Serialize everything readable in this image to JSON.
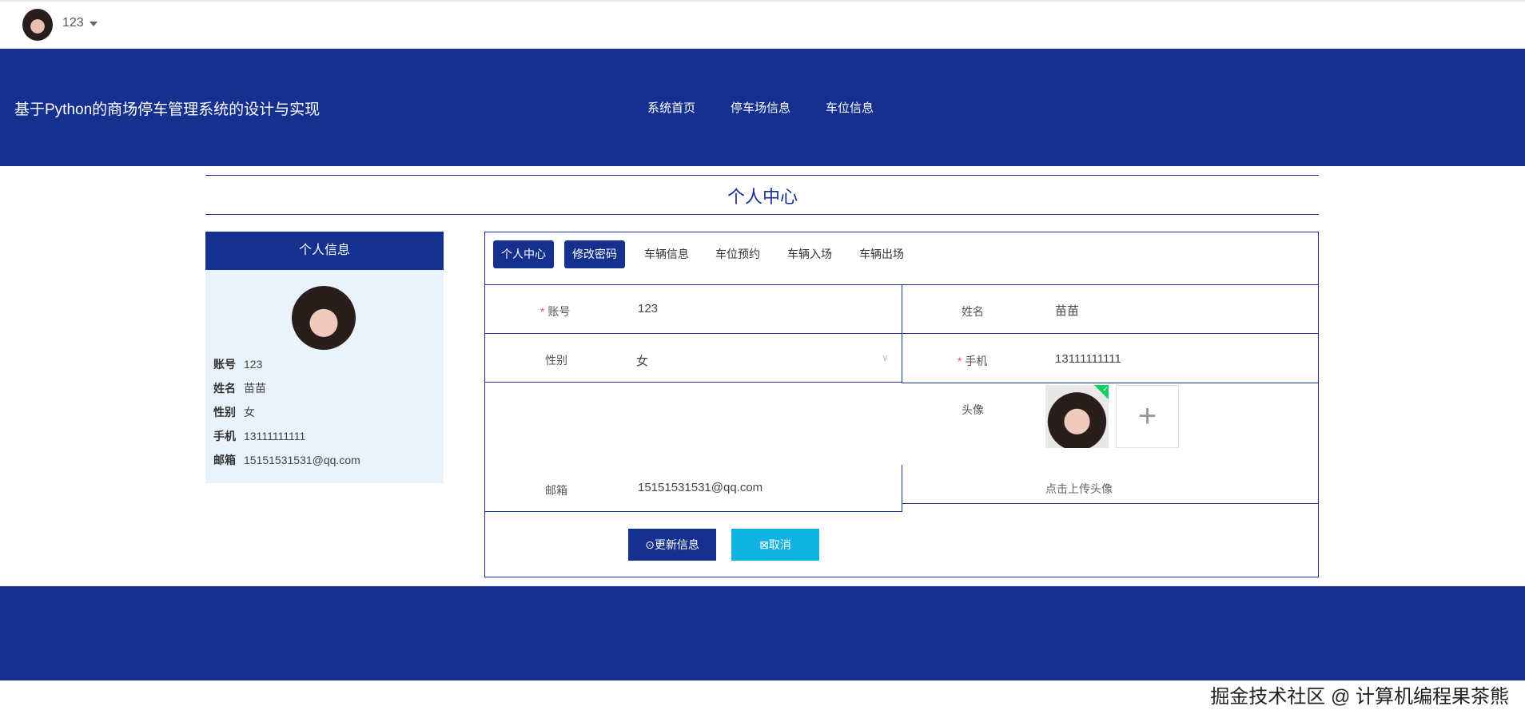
{
  "topbar": {
    "username": "123"
  },
  "header": {
    "title": "基于Python的商场停车管理系统的设计与实现",
    "nav": [
      "系统首页",
      "停车场信息",
      "车位信息"
    ]
  },
  "page_title": "个人中心",
  "profile_card": {
    "title": "个人信息",
    "fields": [
      {
        "label": "账号",
        "value": "123"
      },
      {
        "label": "姓名",
        "value": "苗苗"
      },
      {
        "label": "性别",
        "value": "女"
      },
      {
        "label": "手机",
        "value": "13111111111"
      },
      {
        "label": "邮箱",
        "value": "15151531531@qq.com"
      }
    ]
  },
  "tabs": [
    "个人中心",
    "修改密码",
    "车辆信息",
    "车位预约",
    "车辆入场",
    "车辆出场"
  ],
  "form": {
    "account_label": "账号",
    "account": "123",
    "name_label": "姓名",
    "name": "苗苗",
    "gender_label": "性别",
    "gender": "女",
    "phone_label": "手机",
    "phone": "13111111111",
    "avatar_label": "头像",
    "avatar_hint": "点击上传头像",
    "email_label": "邮箱",
    "email": "15151531531@qq.com",
    "required_mark": "*"
  },
  "buttons": {
    "update": "⊙更新信息",
    "cancel": "⊠取消"
  },
  "watermark": "掘金技术社区 @ 计算机编程果茶熊",
  "colors": {
    "primary": "#15308f",
    "cancel": "#10b3e0"
  }
}
